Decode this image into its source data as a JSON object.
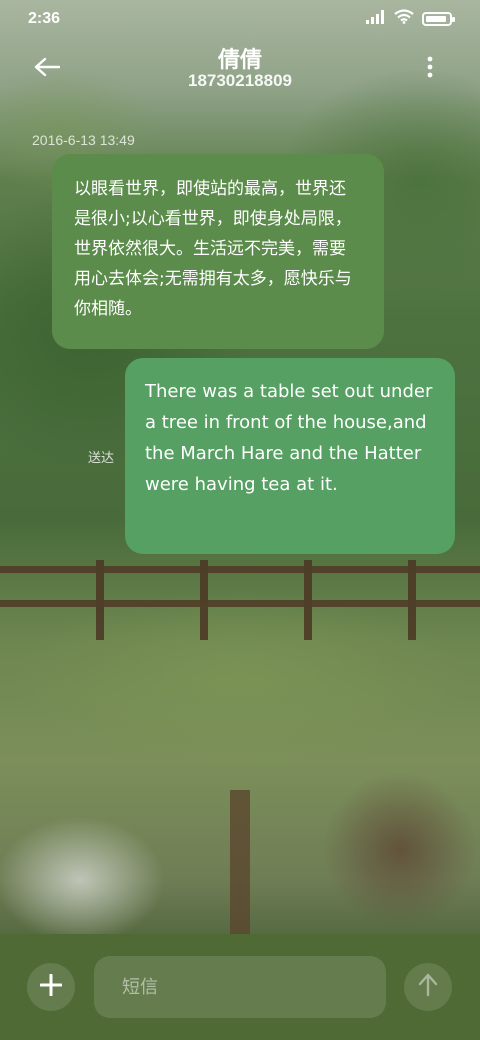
{
  "status_bar": {
    "time": "2:36",
    "battery_level": 0.9,
    "icons": [
      "signal-icon",
      "wifi-icon",
      "battery-icon"
    ]
  },
  "header": {
    "contact_name": "倩倩",
    "contact_number": "18730218809",
    "back_icon": "arrow-left-icon",
    "more_icon": "more-vertical-icon"
  },
  "conversation": {
    "timestamp": "2016-6-13 13:49",
    "messages": [
      {
        "direction": "incoming",
        "text": "以眼看世界，即使站的最高，世界还是很小;以心看世界，即使身处局限，世界依然很大。生活远不完美，需要用心去体会;无需拥有太多，愿快乐与你相随。"
      },
      {
        "direction": "outgoing",
        "text": "There was a table set out under a tree in front of the house,and the March Hare and the Hatter were having tea at it.",
        "status": "送达"
      }
    ]
  },
  "compose": {
    "placeholder": "短信",
    "add_icon": "plus-icon",
    "send_icon": "arrow-up-icon"
  },
  "colors": {
    "incoming_bubble": "#5c8c4c",
    "outgoing_bubble": "#55a062",
    "compose_bar": "#4f6a34"
  }
}
